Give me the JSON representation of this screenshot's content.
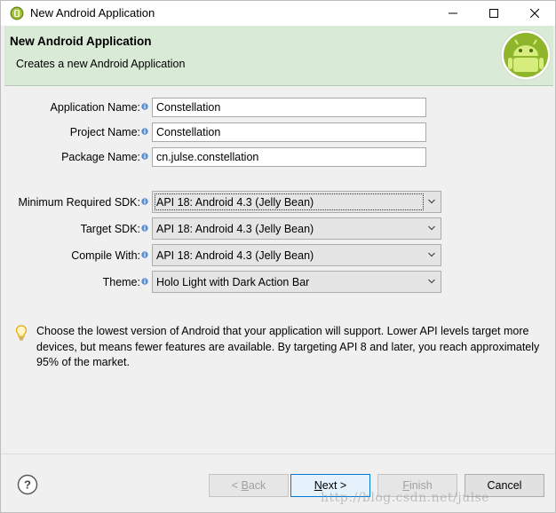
{
  "window": {
    "title": "New Android Application",
    "controls": {
      "minimize": "minimize",
      "maximize": "maximize",
      "close": "close"
    }
  },
  "banner": {
    "heading": "New Android Application",
    "description": "Creates a new Android Application"
  },
  "form": {
    "application_name": {
      "label": "Application Name:",
      "value": "Constellation"
    },
    "project_name": {
      "label": "Project Name:",
      "value": "Constellation"
    },
    "package_name": {
      "label": "Package Name:",
      "value": "cn.julse.constellation"
    },
    "min_sdk": {
      "label": "Minimum Required SDK:",
      "value": "API 18: Android 4.3 (Jelly Bean)"
    },
    "target_sdk": {
      "label": "Target SDK:",
      "value": "API 18: Android 4.3 (Jelly Bean)"
    },
    "compile_with": {
      "label": "Compile With:",
      "value": "API 18: Android 4.3 (Jelly Bean)"
    },
    "theme": {
      "label": "Theme:",
      "value": "Holo Light with Dark Action Bar"
    }
  },
  "hint": {
    "text": "Choose the lowest version of Android that your application will support. Lower API levels target more devices, but means fewer features are available. By targeting API 8 and later, you reach approximately 95% of the market."
  },
  "buttons": {
    "back_prefix": "< ",
    "back_mnemonic": "B",
    "back_rest": "ack",
    "next_mnemonic": "N",
    "next_rest": "ext >",
    "finish_mnemonic": "F",
    "finish_rest": "inish",
    "cancel": "Cancel"
  },
  "watermark": "http://blog.csdn.net/julse",
  "colors": {
    "banner_bg": "#d9ebd7",
    "android_green": "#a4c639",
    "default_button_border": "#0078d7"
  },
  "icons": [
    "android-app-icon",
    "android-logo-icon",
    "info-icon",
    "chevron-down-icon",
    "lightbulb-icon",
    "help-icon"
  ]
}
